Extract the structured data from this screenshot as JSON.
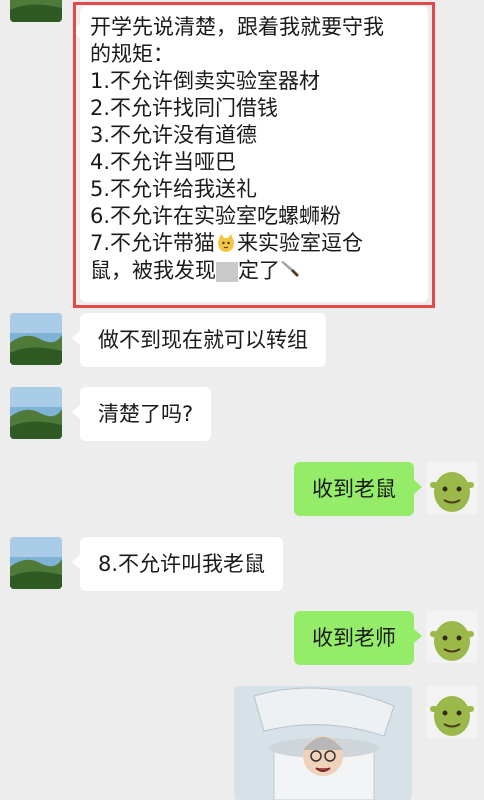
{
  "messages": [
    {
      "lines": [
        "开学先说清楚，跟着我就要守我",
        "的规矩：",
        "1.不允许倒卖实验室器材",
        "2.不允许找同门借钱",
        "3.不允许没有道德",
        "4.不允许当哑巴",
        "5.不允许给我送礼",
        "6.不允许在实验室吃螺蛳粉"
      ],
      "line7_a": "7.不允许带猫",
      "line7_b": "来实验室逗仓",
      "line8_a": "鼠，被我发现",
      "line8_b": "定了"
    },
    {
      "text": "做不到现在就可以转组"
    },
    {
      "text": "清楚了吗?"
    },
    {
      "text": "收到老鼠"
    },
    {
      "text": "8.不允许叫我老鼠"
    },
    {
      "text": "收到老师"
    }
  ],
  "colors": {
    "background": "#ededed",
    "incoming_bubble": "#ffffff",
    "outgoing_bubble": "#95ec69",
    "highlight_border": "#e24a4a"
  },
  "icons": {
    "left_avatar": "landscape-avatar-icon",
    "right_avatar": "shrek-avatar-icon",
    "cat": "cat-emoji-icon",
    "knife": "kitchen-knife-emoji-icon"
  }
}
